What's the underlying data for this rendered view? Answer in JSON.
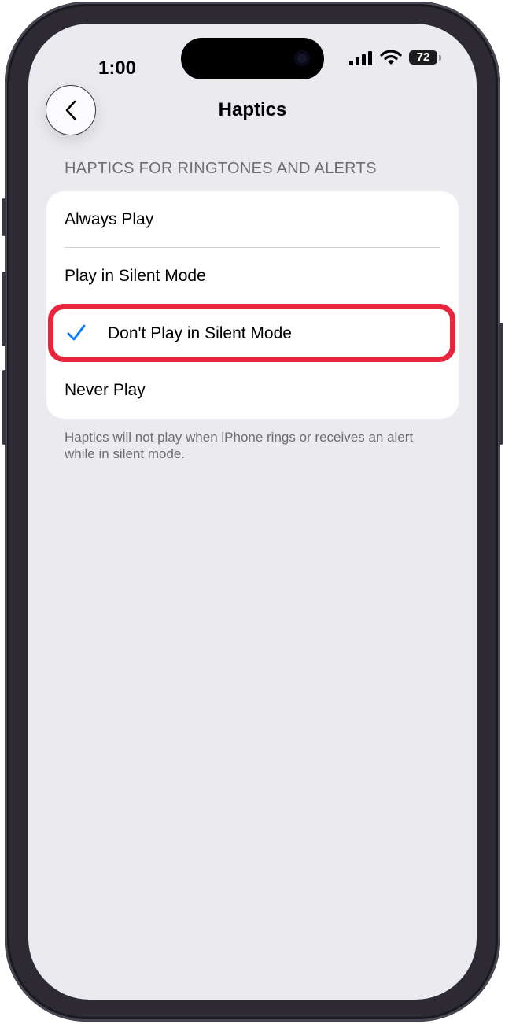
{
  "status_bar": {
    "time": "1:00",
    "battery_level": "72",
    "signal_icon": "signal-bars-icon",
    "wifi_icon": "wifi-icon"
  },
  "nav": {
    "title": "Haptics",
    "back_icon": "chevron-left-icon"
  },
  "section": {
    "header": "HAPTICS FOR RINGTONES AND ALERTS",
    "options": [
      {
        "label": "Always Play",
        "selected": false
      },
      {
        "label": "Play in Silent Mode",
        "selected": false
      },
      {
        "label": "Don't Play in Silent Mode",
        "selected": true
      },
      {
        "label": "Never Play",
        "selected": false
      }
    ],
    "footer": "Haptics will not play when iPhone rings or receives an alert while in silent mode."
  },
  "colors": {
    "accent": "#007aff",
    "highlight": "#e8253f",
    "background": "#ebeaef"
  }
}
